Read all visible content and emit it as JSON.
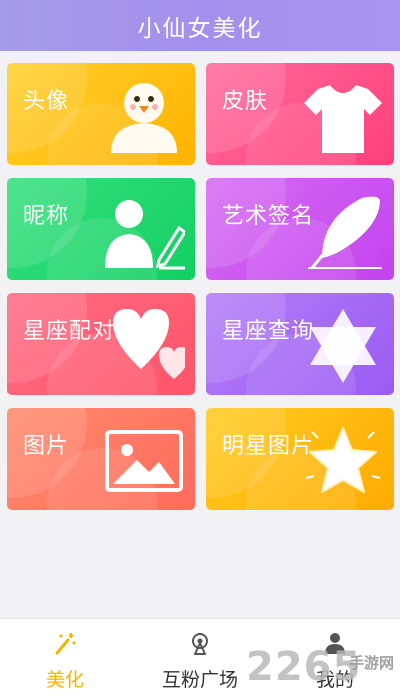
{
  "header": {
    "title": "小仙女美化"
  },
  "cards": [
    {
      "label": "头像",
      "icon": "avatar-figure-icon"
    },
    {
      "label": "皮肤",
      "icon": "tshirt-icon"
    },
    {
      "label": "昵称",
      "icon": "person-pen-icon"
    },
    {
      "label": "艺术签名",
      "icon": "feather-quill-icon"
    },
    {
      "label": "星座配对",
      "icon": "hearts-icon"
    },
    {
      "label": "星座查询",
      "icon": "hexagram-star-icon"
    },
    {
      "label": "图片",
      "icon": "picture-icon"
    },
    {
      "label": "明星图片",
      "icon": "star-icon"
    }
  ],
  "tabbar": {
    "tabs": [
      {
        "label": "美化",
        "icon": "magic-wand-icon",
        "active": true
      },
      {
        "label": "互粉广场",
        "icon": "broadcast-icon",
        "active": false
      },
      {
        "label": "我的",
        "icon": "user-icon",
        "active": false
      }
    ]
  },
  "watermark": {
    "number": "2265",
    "text": "手游网"
  },
  "colors": {
    "header": "#a69be8",
    "tab_active": "#f5b400",
    "tab_inactive": "#333333"
  }
}
